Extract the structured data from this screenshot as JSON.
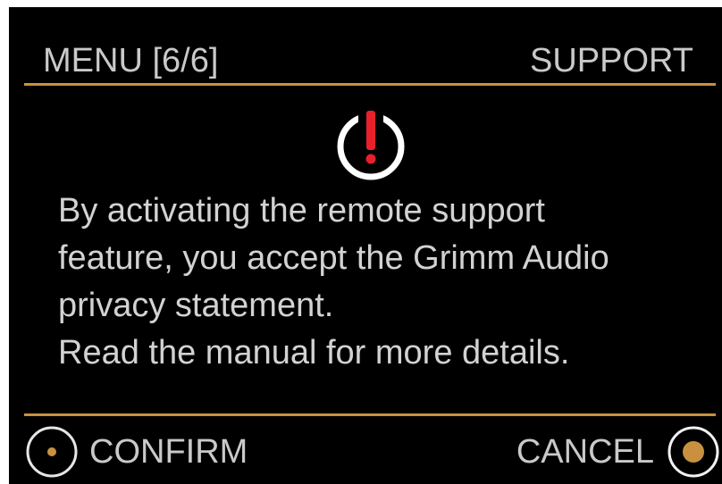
{
  "header": {
    "menu_position": "MENU [6/6]",
    "section": "SUPPORT"
  },
  "alert": {
    "icon": "power-alert-icon"
  },
  "message": {
    "lines": [
      "By activating the remote support",
      "feature, you accept the Grimm Audio",
      "privacy statement.",
      "Read the manual for more details."
    ]
  },
  "footer": {
    "confirm_label": "CONFIRM",
    "cancel_label": "CANCEL",
    "confirm_icon": "knob-icon",
    "cancel_icon": "knob-selected-icon"
  },
  "colors": {
    "background": "#000000",
    "accent": "#c9913f",
    "alert_red": "#e8202a",
    "text": "#cfcfcf"
  }
}
